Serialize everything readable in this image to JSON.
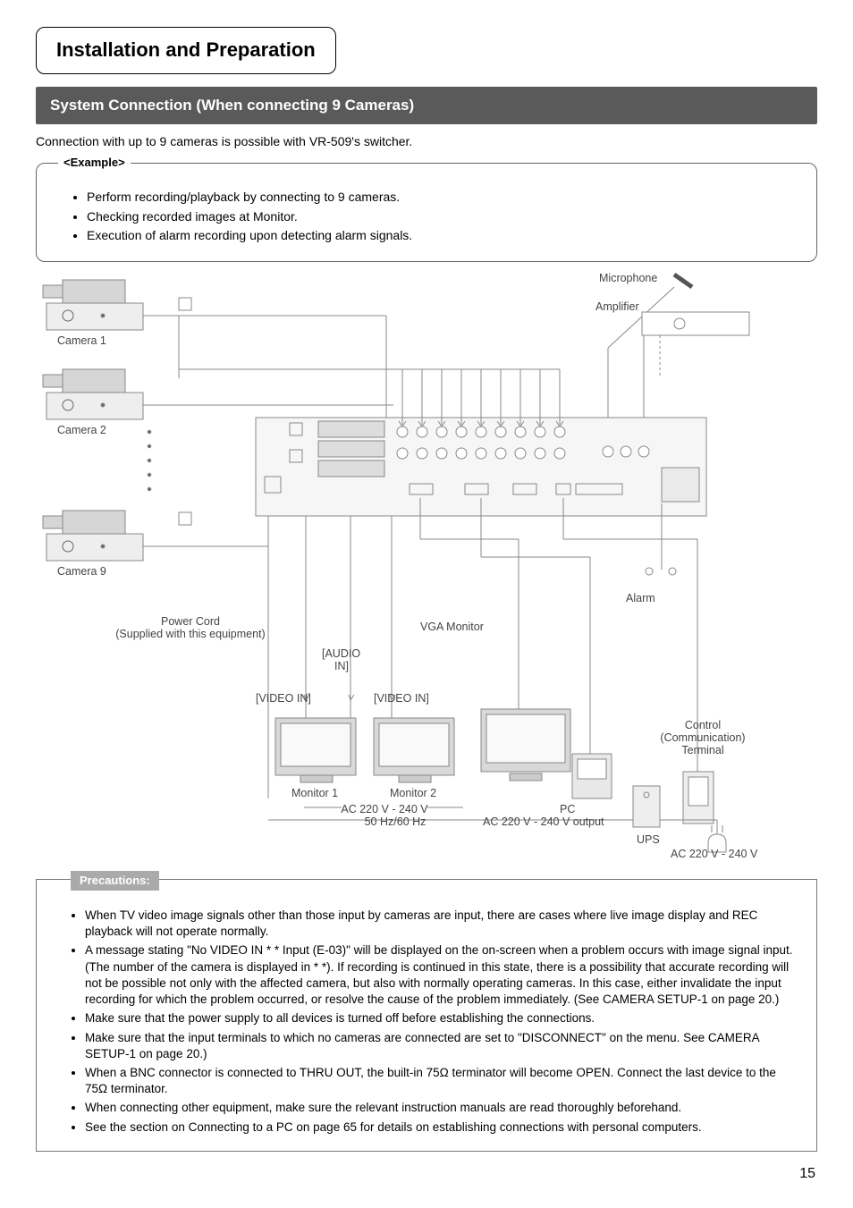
{
  "chapter_title": "Installation and Preparation",
  "section_title": "System Connection (When connecting 9 Cameras)",
  "intro_text": "Connection with up to 9 cameras is possible with VR-509's switcher.",
  "example": {
    "legend": "<Example>",
    "items": [
      "Perform recording/playback by connecting to 9 cameras.",
      "Checking recorded images at Monitor.",
      "Execution of alarm recording upon detecting alarm signals."
    ]
  },
  "diagram_labels": {
    "camera1": "Camera 1",
    "camera2": "Camera 2",
    "camera9": "Camera 9",
    "microphone": "Microphone",
    "amplifier": "Amplifier",
    "power_cord_l1": "Power Cord",
    "power_cord_l2": "(Supplied with this equipment)",
    "audio_in_l1": "[AUDIO",
    "audio_in_l2": "IN]",
    "video_in_left": "[VIDEO IN]",
    "video_in_right": "[VIDEO IN]",
    "vga_monitor": "VGA Monitor",
    "alarm": "Alarm",
    "monitor1": "Monitor 1",
    "monitor2": "Monitor 2",
    "pc": "PC",
    "ups": "UPS",
    "control_l1": "Control",
    "control_l2": "(Communication)",
    "control_l3": "Terminal",
    "ac_main_l1": "AC 220 V - 240 V",
    "ac_main_l2": "50 Hz/60 Hz",
    "ac_output": "AC 220 V - 240 V output",
    "ac_side": "AC 220 V - 240 V"
  },
  "precautions": {
    "legend": "Precautions:",
    "items": [
      "When TV video image signals other than those input by cameras are input, there are cases where live image display and REC playback will not operate normally.",
      "A message stating \"No VIDEO IN * * Input (E-03)\" will be displayed on the on-screen when a problem occurs with image signal input. (The number of the camera is displayed in * *). If recording is continued in this state, there is a possibility that accurate recording will not be possible not only with the affected camera, but also with normally operating cameras. In this case, either invalidate the input recording for which the problem occurred, or resolve the cause of the problem immediately. (See CAMERA SETUP-1 on page 20.)",
      "Make sure that the power supply to all devices is turned off before establishing the connections.",
      "Make sure that the input terminals to which no cameras are connected are set to \"DISCONNECT\" on the menu. See CAMERA SETUP-1 on page 20.)",
      "When a BNC connector is connected to THRU OUT, the built-in 75Ω terminator will become OPEN. Connect the last device to the 75Ω terminator.",
      "When connecting other equipment, make sure the relevant instruction manuals are read thoroughly beforehand.",
      "See the section on Connecting to a PC on page 65 for details on establishing connections with personal computers."
    ]
  },
  "page_number": "15"
}
